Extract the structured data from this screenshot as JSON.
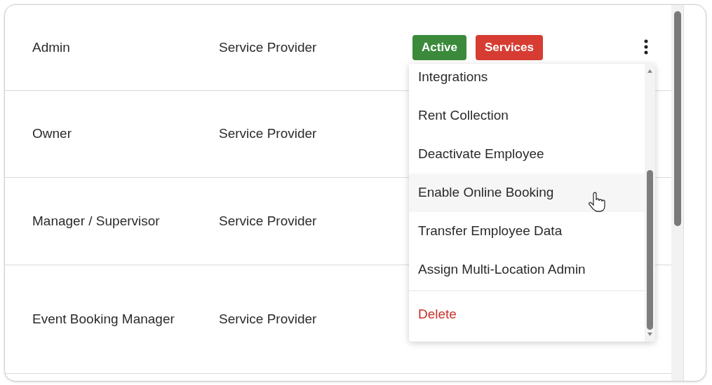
{
  "rows": [
    {
      "name": "Admin",
      "role": "Service Provider",
      "badges": [
        {
          "label": "Active",
          "color": "#3b8a3b"
        },
        {
          "label": "Services",
          "color": "#d63c32"
        }
      ]
    },
    {
      "name": "Owner",
      "role": "Service Provider",
      "badges": []
    },
    {
      "name": "Manager / Supervisor",
      "role": "Service Provider",
      "badges": []
    },
    {
      "name": "Event Booking Manager",
      "role": "Service Provider",
      "badges": []
    }
  ],
  "menu": {
    "open": true,
    "items": [
      {
        "label": "Integrations",
        "kind": "normal",
        "selected": false
      },
      {
        "label": "Rent Collection",
        "kind": "normal",
        "selected": false
      },
      {
        "label": "Deactivate Employee",
        "kind": "normal",
        "selected": false
      },
      {
        "label": "Enable Online Booking",
        "kind": "normal",
        "selected": true
      },
      {
        "label": "Transfer Employee Data",
        "kind": "normal",
        "selected": false
      },
      {
        "label": "Assign Multi-Location Admin",
        "kind": "normal",
        "selected": false
      },
      {
        "label": "Delete",
        "kind": "danger",
        "selected": false
      }
    ]
  }
}
